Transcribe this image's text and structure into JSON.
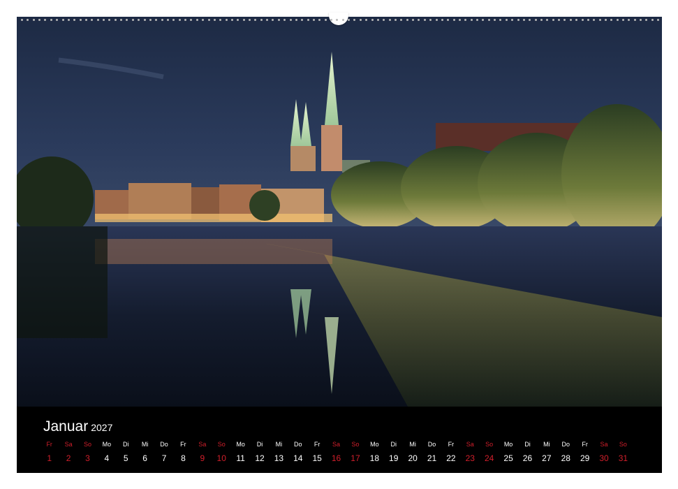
{
  "calendar": {
    "month": "Januar",
    "year": "2027",
    "colors": {
      "weekday": "#ffffff",
      "weekend": "#d21f2b",
      "strip_background": "#000000"
    },
    "days": [
      {
        "name": "Fr",
        "number": "1",
        "weekend": true
      },
      {
        "name": "Sa",
        "number": "2",
        "weekend": true
      },
      {
        "name": "So",
        "number": "3",
        "weekend": true
      },
      {
        "name": "Mo",
        "number": "4",
        "weekend": false
      },
      {
        "name": "Di",
        "number": "5",
        "weekend": false
      },
      {
        "name": "Mi",
        "number": "6",
        "weekend": false
      },
      {
        "name": "Do",
        "number": "7",
        "weekend": false
      },
      {
        "name": "Fr",
        "number": "8",
        "weekend": false
      },
      {
        "name": "Sa",
        "number": "9",
        "weekend": true
      },
      {
        "name": "So",
        "number": "10",
        "weekend": true
      },
      {
        "name": "Mo",
        "number": "11",
        "weekend": false
      },
      {
        "name": "Di",
        "number": "12",
        "weekend": false
      },
      {
        "name": "Mi",
        "number": "13",
        "weekend": false
      },
      {
        "name": "Do",
        "number": "14",
        "weekend": false
      },
      {
        "name": "Fr",
        "number": "15",
        "weekend": false
      },
      {
        "name": "Sa",
        "number": "16",
        "weekend": true
      },
      {
        "name": "So",
        "number": "17",
        "weekend": true
      },
      {
        "name": "Mo",
        "number": "18",
        "weekend": false
      },
      {
        "name": "Di",
        "number": "19",
        "weekend": false
      },
      {
        "name": "Mi",
        "number": "20",
        "weekend": false
      },
      {
        "name": "Do",
        "number": "21",
        "weekend": false
      },
      {
        "name": "Fr",
        "number": "22",
        "weekend": false
      },
      {
        "name": "Sa",
        "number": "23",
        "weekend": true
      },
      {
        "name": "So",
        "number": "24",
        "weekend": true
      },
      {
        "name": "Mo",
        "number": "25",
        "weekend": false
      },
      {
        "name": "Di",
        "number": "26",
        "weekend": false
      },
      {
        "name": "Mi",
        "number": "27",
        "weekend": false
      },
      {
        "name": "Do",
        "number": "28",
        "weekend": false
      },
      {
        "name": "Fr",
        "number": "29",
        "weekend": false
      },
      {
        "name": "Sa",
        "number": "30",
        "weekend": true
      },
      {
        "name": "So",
        "number": "31",
        "weekend": true
      }
    ]
  }
}
